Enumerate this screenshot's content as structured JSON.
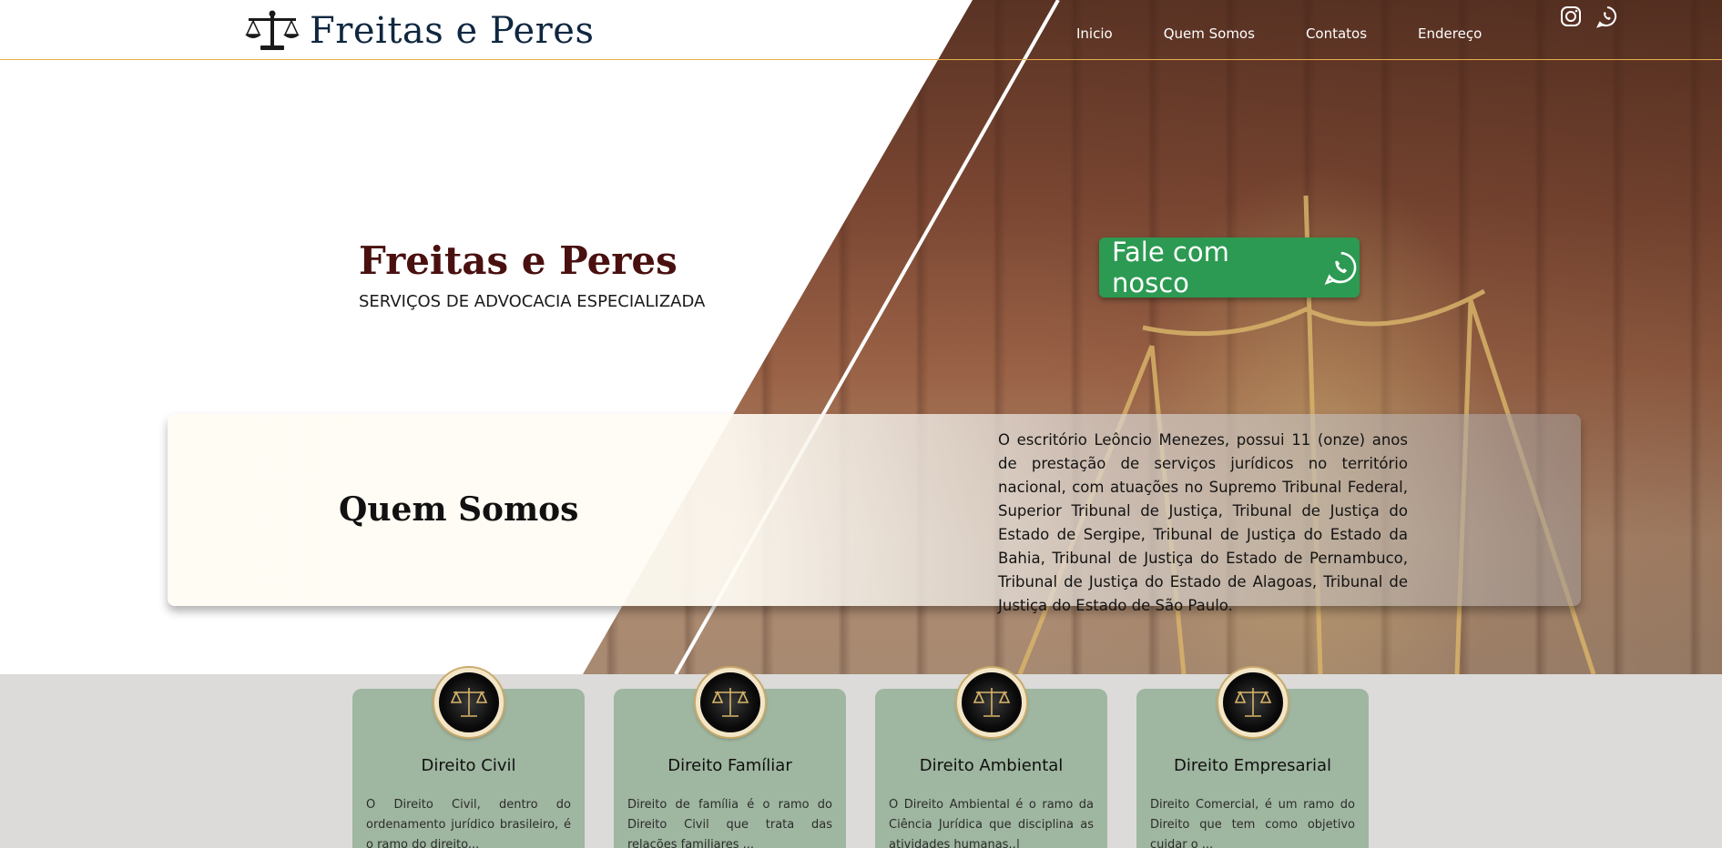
{
  "header": {
    "logo_text": "Freitas e Peres",
    "nav": [
      "Inicio",
      "Quem Somos",
      "Contatos",
      "Endereço"
    ],
    "social": [
      "instagram-icon",
      "whatsapp-icon"
    ]
  },
  "hero": {
    "title": "Freitas e Peres",
    "subtitle": "SERVIÇOS DE ADVOCACIA ESPECIALIZADA",
    "cta_label": "Fale com nosco"
  },
  "about": {
    "title": "Quem Somos",
    "text": "O escritório Leôncio Menezes, possui 11 (onze) anos de prestação de serviços jurídicos no território nacional, com atuações no Supremo Tribunal Federal, Superior Tribunal de Justiça, Tribunal de Justiça do Estado de Sergipe, Tribunal de Justiça do Estado da Bahia, Tribunal de Justiça do Estado de Pernambuco, Tribunal de Justiça do Estado de Alagoas, Tribunal de Justiça do Estado de São Paulo."
  },
  "services": [
    {
      "title": "Direito Civil",
      "text": "O Direito Civil, dentro do ordenamento jurídico brasileiro, é o ramo do direito..."
    },
    {
      "title": "Direito Famíliar",
      "text": "Direito de família é o ramo do Direito Civil que trata das relações familiares ..."
    },
    {
      "title": "Direito Ambiental",
      "text": "O Direito Ambiental é o ramo da Ciência Jurídica que disciplina as atividades humanas..|"
    },
    {
      "title": "Direito Empresarial",
      "text": "Direito Comercial, é um ramo do Direito que tem como objetivo cuidar o ..."
    }
  ],
  "colors": {
    "accent_line": "#e8b24a",
    "cta": "#2c9a52",
    "card": "#9fb6a0",
    "title_dark_red": "#4a1010"
  }
}
